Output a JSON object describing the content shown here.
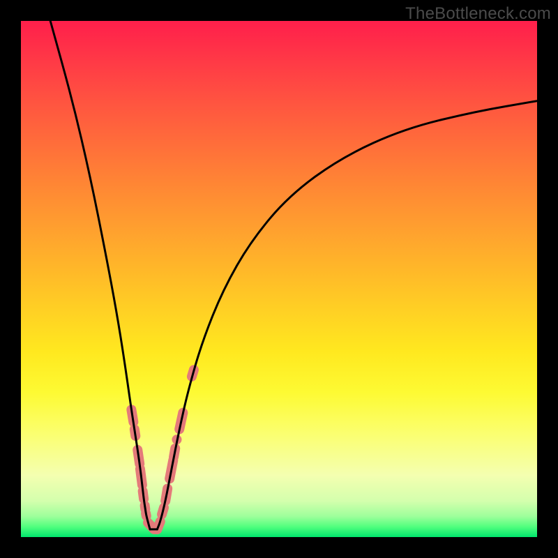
{
  "watermark": "TheBottleneck.com",
  "chart_data": {
    "type": "line",
    "title": "",
    "xlabel": "",
    "ylabel": "",
    "xlim": [
      0,
      100
    ],
    "ylim": [
      0,
      100
    ],
    "background_gradient": {
      "orientation": "vertical",
      "stops": [
        {
          "pos": 0,
          "color": "#ff1f4b"
        },
        {
          "pos": 24,
          "color": "#ff6e3a"
        },
        {
          "pos": 48,
          "color": "#ffb729"
        },
        {
          "pos": 72,
          "color": "#fdfa33"
        },
        {
          "pos": 100,
          "color": "#00e66d"
        }
      ]
    },
    "series": [
      {
        "name": "left-curve",
        "x": [
          5.7,
          10.0,
          13.5,
          16.5,
          18.5,
          20.0,
          21.4,
          22.2,
          23.0,
          23.5,
          23.8,
          24.1,
          24.3,
          25.0
        ],
        "y": [
          100.0,
          84.5,
          69.5,
          54.5,
          43.8,
          34.5,
          24.7,
          19.6,
          14.2,
          10.1,
          7.4,
          5.4,
          4.1,
          1.5
        ]
      },
      {
        "name": "right-curve",
        "x": [
          26.4,
          27.0,
          28.0,
          29.1,
          30.7,
          32.4,
          35.1,
          39.2,
          44.6,
          52.0,
          62.2,
          74.3,
          87.8,
          100.0
        ],
        "y": [
          1.5,
          3.0,
          7.0,
          12.8,
          20.9,
          28.4,
          37.8,
          48.0,
          57.4,
          66.2,
          73.6,
          79.1,
          82.4,
          84.5
        ]
      }
    ],
    "bottom_flat": {
      "name": "bottom-join",
      "x": [
        25.0,
        26.4
      ],
      "y": [
        1.5,
        1.5
      ]
    },
    "highlight_markers_left": [
      {
        "x1": 21.4,
        "y1": 24.7,
        "x2": 21.8,
        "y2": 22.3
      },
      {
        "x1": 22.0,
        "y1": 20.9,
        "x2": 22.2,
        "y2": 19.6
      },
      {
        "x1": 22.6,
        "y1": 16.9,
        "x2": 23.0,
        "y2": 14.2
      },
      {
        "x1": 23.1,
        "y1": 13.2,
        "x2": 23.5,
        "y2": 10.1
      },
      {
        "x1": 23.6,
        "y1": 8.9,
        "x2": 23.8,
        "y2": 7.4
      },
      {
        "x1": 24.0,
        "y1": 6.1,
        "x2": 24.1,
        "y2": 5.4
      },
      {
        "x1": 24.2,
        "y1": 4.6,
        "x2": 24.3,
        "y2": 4.1
      },
      {
        "x1": 24.6,
        "y1": 2.8,
        "x2": 25.7,
        "y2": 1.6
      },
      {
        "x1": 25.8,
        "y1": 1.5,
        "x2": 26.4,
        "y2": 1.5
      }
    ],
    "highlight_markers_right": [
      {
        "x1": 26.4,
        "y1": 1.5,
        "x2": 27.0,
        "y2": 3.0
      },
      {
        "x1": 27.3,
        "y1": 4.4,
        "x2": 27.7,
        "y2": 5.7
      },
      {
        "x1": 28.0,
        "y1": 7.0,
        "x2": 28.4,
        "y2": 9.4
      },
      {
        "x1": 28.8,
        "y1": 11.3,
        "x2": 29.5,
        "y2": 14.9
      },
      {
        "x1": 29.6,
        "y1": 15.5,
        "x2": 29.9,
        "y2": 17.2
      },
      {
        "x1": 30.7,
        "y1": 20.9,
        "x2": 31.4,
        "y2": 24.1
      },
      {
        "x1": 33.1,
        "y1": 31.1,
        "x2": 33.5,
        "y2": 32.4
      }
    ],
    "highlight_dots": [
      {
        "x": 30.2,
        "y": 18.9
      }
    ]
  }
}
